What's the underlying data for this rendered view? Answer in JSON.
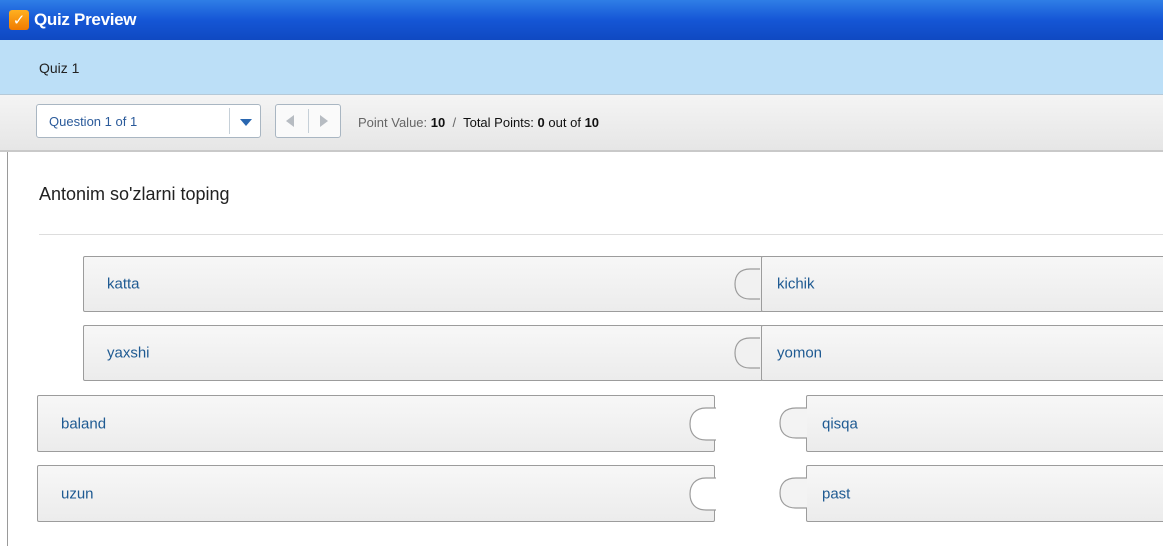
{
  "window": {
    "title": "Quiz Preview",
    "icon": "quiz-app-icon"
  },
  "quiz": {
    "name": "Quiz 1"
  },
  "navigation": {
    "question_select": "Question 1 of 1",
    "prev_icon": "arrow-left-icon",
    "next_icon": "arrow-right-icon"
  },
  "points": {
    "point_value_label": "Point Value:",
    "point_value": "10",
    "separator": "/",
    "total_points_label": "Total Points:",
    "total_points": "0",
    "out_of_label": "out of",
    "out_of": "10"
  },
  "question": {
    "text": "Antonim so'zlarni toping"
  },
  "matched_pairs": [
    {
      "left": "katta",
      "right": "kichik"
    },
    {
      "left": "yaxshi",
      "right": "yomon"
    }
  ],
  "unmatched": {
    "left_items": [
      "baland",
      "uzun"
    ],
    "right_items": [
      "qisqa",
      "past"
    ]
  },
  "colors": {
    "title_bar": "#1556d6",
    "quiz_bar": "#bcdff7",
    "answer_text": "#1e5a92"
  }
}
